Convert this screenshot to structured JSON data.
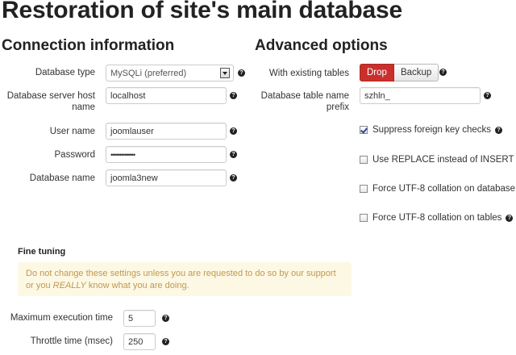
{
  "page_title": "Restoration of site's main database",
  "connection": {
    "title": "Connection information",
    "fields": [
      {
        "label": "Database type",
        "value": "MySQLi (preferred)"
      },
      {
        "label_line1": "Database server host",
        "label_line2": "name",
        "value": "localhost"
      },
      {
        "label": "User name",
        "value": "joomlauser"
      },
      {
        "label": "Password",
        "value": "••••••••••••••"
      },
      {
        "label": "Database name",
        "value": "joomla3new"
      }
    ]
  },
  "advanced": {
    "title": "Advanced options",
    "existing_tables_label": "With existing tables",
    "drop_label": "Drop",
    "backup_label": "Backup",
    "prefix_label_line1": "Database table name",
    "prefix_label_line2": "prefix",
    "prefix_value": "szhln_",
    "checkboxes": [
      {
        "label": "Suppress foreign key checks",
        "checked": true
      },
      {
        "label": "Use REPLACE instead of INSERT",
        "checked": false
      },
      {
        "label": "Force UTF-8 collation on database",
        "checked": false
      },
      {
        "label": "Force UTF-8 collation on tables",
        "checked": false
      }
    ]
  },
  "fine_tuning": {
    "title": "Fine tuning",
    "warning_part1": "Do not change these settings unless you are requested to do so by our support or",
    "warning_part2": "you ",
    "warning_emph": "REALLY",
    "warning_part3": " know what you are doing.",
    "max_exec_label": "Maximum execution time",
    "max_exec_value": "5",
    "throttle_label": "Throttle time (msec)",
    "throttle_value": "250"
  },
  "help_glyph": "?",
  "icons": {
    "help": "question-circle-icon",
    "select_arrow": "chevron-down-icon",
    "check": "checkmark-icon"
  },
  "colors": {
    "drop_active": "#c9302c",
    "warning_bg": "#fcf8e3",
    "warning_text": "#c09853"
  }
}
